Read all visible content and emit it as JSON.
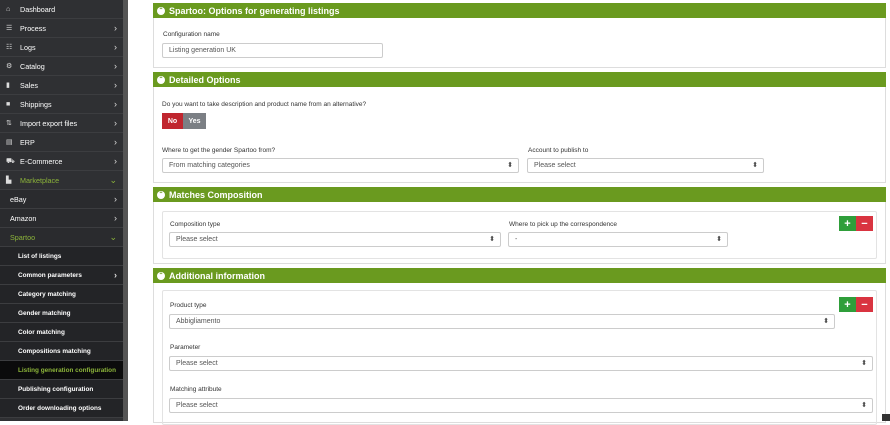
{
  "sidebar": {
    "items": [
      {
        "label": "Dashboard",
        "icon": "home-icon",
        "glyph": "⌂"
      },
      {
        "label": "Process",
        "icon": "tasks-icon",
        "glyph": "☰"
      },
      {
        "label": "Logs",
        "icon": "list-icon",
        "glyph": "☷"
      },
      {
        "label": "Catalog",
        "icon": "gear-icon",
        "glyph": "⚙"
      },
      {
        "label": "Sales",
        "icon": "chart-icon",
        "glyph": "▮"
      },
      {
        "label": "Shippings",
        "icon": "truck-icon",
        "glyph": "■"
      },
      {
        "label": "Import export files",
        "icon": "transfer-icon",
        "glyph": "⇅"
      },
      {
        "label": "ERP",
        "icon": "server-icon",
        "glyph": "▤"
      },
      {
        "label": "E-Commerce",
        "icon": "cart-icon",
        "glyph": "⛟"
      },
      {
        "label": "Marketplace",
        "icon": "store-icon",
        "glyph": "▙"
      }
    ],
    "marketplace_items": [
      {
        "label": "eBay"
      },
      {
        "label": "Amazon"
      },
      {
        "label": "Spartoo"
      }
    ],
    "spartoo_items": [
      {
        "label": "List of listings"
      },
      {
        "label": "Common parameters"
      },
      {
        "label": "Category matching"
      },
      {
        "label": "Gender matching"
      },
      {
        "label": "Color matching"
      },
      {
        "label": "Compositions matching"
      },
      {
        "label": "Listing generation configuration"
      },
      {
        "label": "Publishing configuration"
      },
      {
        "label": "Order downloading options"
      }
    ],
    "chevron_right": "›",
    "chevron_down": "⌄"
  },
  "options_panel": {
    "title": "Spartoo: Options for generating listings",
    "config_label": "Configuration name",
    "config_value": "Listing generation UK"
  },
  "detailed_panel": {
    "title": "Detailed Options",
    "question": "Do you want to take description and product name from an alternative?",
    "no_label": "No",
    "yes_label": "Yes",
    "gender_label": "Where to get the gender Spartoo from?",
    "gender_value": "From matching categories",
    "account_label": "Account to publish to",
    "account_value": "Please select"
  },
  "matches_panel": {
    "title": "Matches Composition",
    "composition_label": "Composition type",
    "composition_value": "Please select",
    "correspondence_label": "Where to pick up the correspondence",
    "correspondence_value": "-"
  },
  "additional_panel": {
    "title": "Additional information",
    "product_type_label": "Product type",
    "product_type_value": "Abbigliamento",
    "parameter_label": "Parameter",
    "parameter_value": "Please select",
    "matching_attr_label": "Matching attribute",
    "matching_attr_value": "Please select"
  },
  "buttons": {
    "add": "+",
    "remove": "−"
  },
  "select_arrow": "⬍",
  "collapse_glyph": "⌃",
  "colors": {
    "accent": "#6a9a1f",
    "sidebar": "#2f3033",
    "active": "#8cb43a",
    "danger": "#d93440",
    "success": "#2f9e3a"
  }
}
